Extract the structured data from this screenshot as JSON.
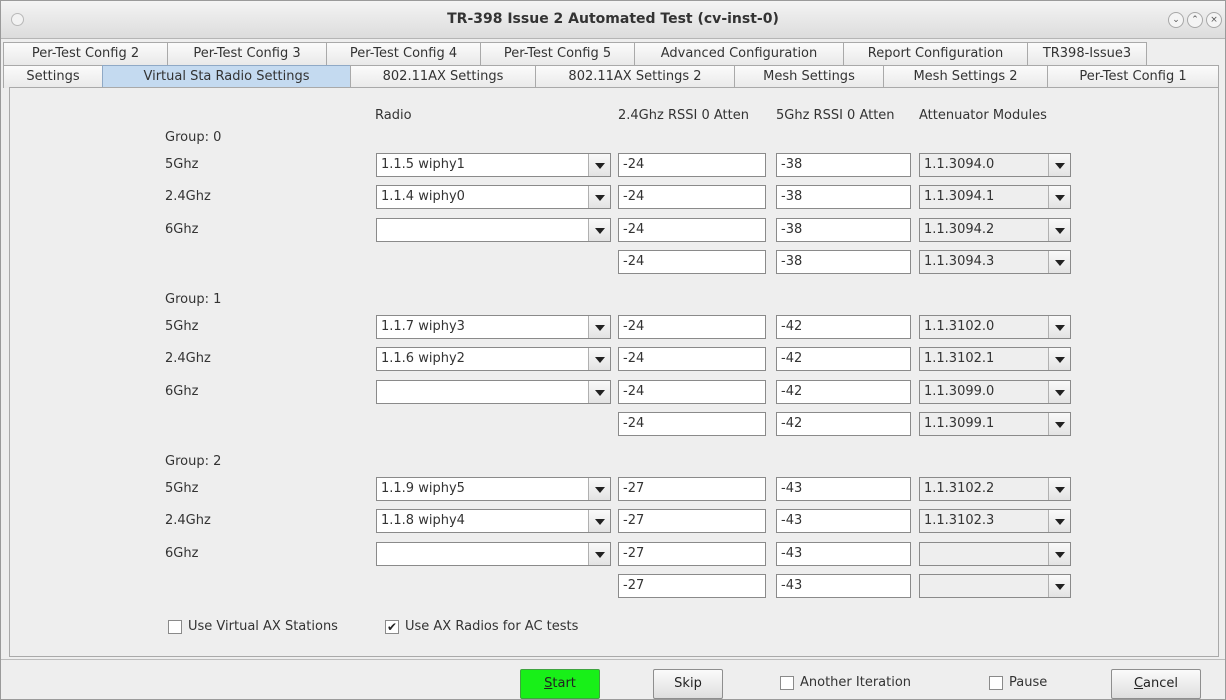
{
  "window": {
    "title": "TR-398 Issue 2 Automated Test  (cv-inst-0)",
    "controls": [
      "minimize",
      "maximize",
      "close"
    ]
  },
  "tabs": {
    "row1": [
      "Per-Test Config 2",
      "Per-Test Config 3",
      "Per-Test Config 4",
      "Per-Test Config 5",
      "Advanced Configuration",
      "Report Configuration",
      "TR398-Issue3"
    ],
    "row2": [
      "Settings",
      "Virtual Sta Radio Settings",
      "802.11AX Settings",
      "802.11AX Settings 2",
      "Mesh Settings",
      "Mesh Settings 2",
      "Per-Test Config 1"
    ],
    "active": "Virtual Sta Radio Settings"
  },
  "headers": {
    "radio": "Radio",
    "rssi24": "2.4Ghz RSSI 0 Atten",
    "rssi5": "5Ghz RSSI 0 Atten",
    "attenuator": "Attenuator Modules"
  },
  "groups": [
    {
      "label": "Group: 0",
      "rows": [
        {
          "band": "5Ghz",
          "radio": "1.1.5 wiphy1",
          "rssi24": "-24",
          "rssi5": "-38",
          "atten": "1.1.3094.0"
        },
        {
          "band": "2.4Ghz",
          "radio": "1.1.4 wiphy0",
          "rssi24": "-24",
          "rssi5": "-38",
          "atten": "1.1.3094.1"
        },
        {
          "band": "6Ghz",
          "radio": "",
          "rssi24": "-24",
          "rssi5": "-38",
          "atten": "1.1.3094.2"
        },
        {
          "band": "",
          "radio": null,
          "rssi24": "-24",
          "rssi5": "-38",
          "atten": "1.1.3094.3"
        }
      ]
    },
    {
      "label": "Group: 1",
      "rows": [
        {
          "band": "5Ghz",
          "radio": "1.1.7 wiphy3",
          "rssi24": "-24",
          "rssi5": "-42",
          "atten": "1.1.3102.0"
        },
        {
          "band": "2.4Ghz",
          "radio": "1.1.6 wiphy2",
          "rssi24": "-24",
          "rssi5": "-42",
          "atten": "1.1.3102.1"
        },
        {
          "band": "6Ghz",
          "radio": "",
          "rssi24": "-24",
          "rssi5": "-42",
          "atten": "1.1.3099.0"
        },
        {
          "band": "",
          "radio": null,
          "rssi24": "-24",
          "rssi5": "-42",
          "atten": "1.1.3099.1"
        }
      ]
    },
    {
      "label": "Group: 2",
      "rows": [
        {
          "band": "5Ghz",
          "radio": "1.1.9 wiphy5",
          "rssi24": "-27",
          "rssi5": "-43",
          "atten": "1.1.3102.2"
        },
        {
          "band": "2.4Ghz",
          "radio": "1.1.8 wiphy4",
          "rssi24": "-27",
          "rssi5": "-43",
          "atten": "1.1.3102.3"
        },
        {
          "band": "6Ghz",
          "radio": "",
          "rssi24": "-27",
          "rssi5": "-43",
          "atten": ""
        },
        {
          "band": "",
          "radio": null,
          "rssi24": "-27",
          "rssi5": "-43",
          "atten": ""
        }
      ]
    }
  ],
  "options": {
    "virtual_ax": {
      "label": "Use Virtual AX Stations",
      "checked": false
    },
    "ax_radios_ac": {
      "label": "Use AX Radios for AC tests",
      "checked": true
    }
  },
  "footer": {
    "start": {
      "label": "Start",
      "mnemonic": "S",
      "color": "#18f018"
    },
    "skip": "Skip",
    "another_iteration": {
      "label": "Another Iteration",
      "checked": false
    },
    "pause": {
      "label": "Pause",
      "checked": false
    },
    "cancel": {
      "label": "Cancel",
      "mnemonic": "C"
    }
  }
}
